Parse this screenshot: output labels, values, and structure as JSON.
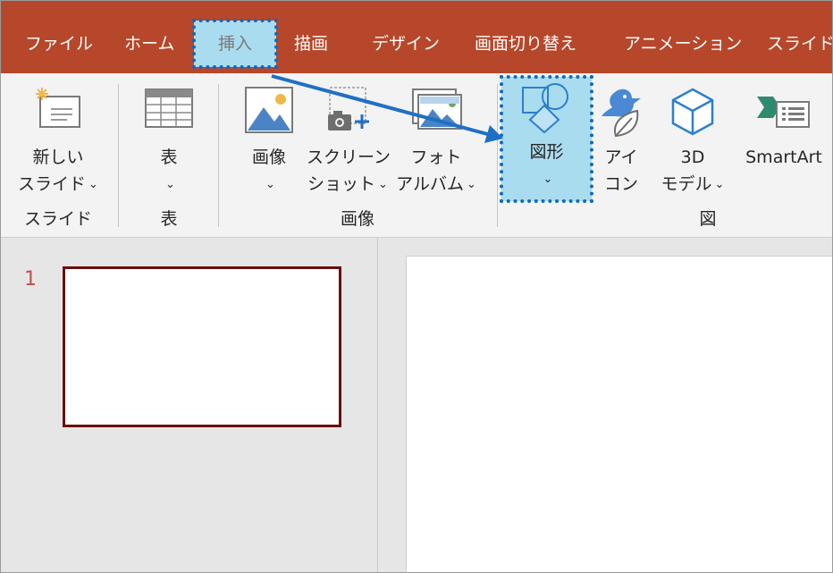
{
  "ribbon_tabs": [
    {
      "label": "ファイル",
      "active": false
    },
    {
      "label": "ホーム",
      "active": false
    },
    {
      "label": "挿入",
      "active": true
    },
    {
      "label": "描画",
      "active": false
    },
    {
      "label": "デザイン",
      "active": false
    },
    {
      "label": "画面切り替え",
      "active": false
    },
    {
      "label": "アニメーション",
      "active": false
    },
    {
      "label": "スライド",
      "active": false
    }
  ],
  "ribbon": {
    "new_slide": {
      "line1": "新しい",
      "line2": "スライド",
      "icon": "new-slide-icon"
    },
    "table": {
      "line1": "表",
      "icon": "table-icon"
    },
    "picture": {
      "line1": "画像",
      "icon": "picture-icon"
    },
    "screenshot": {
      "line1": "スクリーン",
      "line2": "ショット",
      "icon": "screenshot-icon"
    },
    "photo_album": {
      "line1": "フォト",
      "line2": "アルバム",
      "icon": "photo-album-icon"
    },
    "shapes": {
      "line1": "図形",
      "icon": "shapes-icon",
      "highlighted": true
    },
    "icons": {
      "line1": "アイ",
      "line2": "コン",
      "icon": "bird-leaf-icon"
    },
    "models_3d": {
      "line1": "3D",
      "line2": "モデル",
      "icon": "cube-icon"
    },
    "smartart": {
      "line1": "SmartArt",
      "icon": "smartart-icon"
    },
    "caret": "⌄",
    "groups": {
      "slides": "スライド",
      "tables": "表",
      "images": "画像",
      "illustrations": "図"
    }
  },
  "slides_panel": {
    "slides": [
      {
        "number": "1"
      }
    ]
  },
  "colors": {
    "tab_bar": "#b7472a",
    "ribbon": "#f3f3f3",
    "highlight_fill": "#aadcef",
    "highlight_border": "#0c6bc0",
    "slide_thumb_border": "#6b0d0d",
    "slide_number": "#c0504d"
  }
}
